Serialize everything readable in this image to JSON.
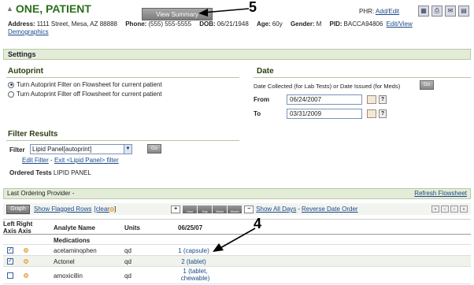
{
  "header": {
    "patient_name": "ONE, PATIENT",
    "view_summary": "View Summary",
    "phr_label": "PHR:",
    "phr_link": "Add/Edit",
    "address_label": "Address:",
    "address": "1111 Street, Mesa, AZ 88888",
    "phone_label": "Phone:",
    "phone": "(555) 555-5555",
    "dob_label": "DOB:",
    "dob": "06/21/1948",
    "age_label": "Age:",
    "age": "60y",
    "gender_label": "Gender:",
    "gender": "M",
    "pid_label": "PID:",
    "pid": "BACCA94806",
    "edit_link": "Edit/View",
    "demographics_link": "Demographics"
  },
  "callouts": {
    "top": "5",
    "table": "4"
  },
  "settings": {
    "bar_title": "Settings",
    "autoprint": {
      "title": "Autoprint",
      "option_on": "Turn Autoprint Filter on Flowsheet for current patient",
      "option_off": "Turn Autoprint Filter off Flowsheet for current patient",
      "selected": "on"
    },
    "date": {
      "title": "Date",
      "description": "Date Collected (for Lab Tests) or Date Issued (for Meds)",
      "go": "Go",
      "from_label": "From",
      "from_value": "06/24/2007",
      "to_label": "To",
      "to_value": "03/31/2009",
      "help": "?"
    }
  },
  "filter": {
    "title": "Filter Results",
    "label": "Filter",
    "selected": "Lipid Panel[autoprint]",
    "go": "Go",
    "edit_link": "Edit Filter",
    "separator": "-",
    "exit_link": "Exit <Lipid Panel> filter",
    "ordered_label": "Ordered Tests",
    "ordered_value": "LIPID PANEL"
  },
  "flowsheet": {
    "last_provider": "Last Ordering Provider -",
    "refresh": "Refresh Flowsheet",
    "graph": "Graph",
    "show_flagged": "Show Flagged Rows",
    "clear": "[clear",
    "clear_end": "]",
    "periods": [
      "Hour",
      "Day",
      "Week",
      "Month"
    ],
    "show_all_days": "Show All Days",
    "separator": "-",
    "reverse_date": "Reverse Date Order",
    "nav": [
      "«",
      "‹",
      "›",
      "»"
    ],
    "columns": {
      "left_right": "Left Right",
      "axis_axis": "Axis Axis",
      "analyte": "Analyte Name",
      "units": "Units",
      "date": "06/25/07"
    },
    "group": "Medications",
    "rows": [
      {
        "name": "acetaminophen",
        "units": "qd",
        "value": "1 (capsule)",
        "checked": true
      },
      {
        "name": "Actonel",
        "units": "qd",
        "value": "2 (tablet)",
        "checked": true
      },
      {
        "name": "amoxicillin",
        "units": "qd",
        "value": "1 (tablet, chewable)",
        "checked": false
      }
    ]
  }
}
